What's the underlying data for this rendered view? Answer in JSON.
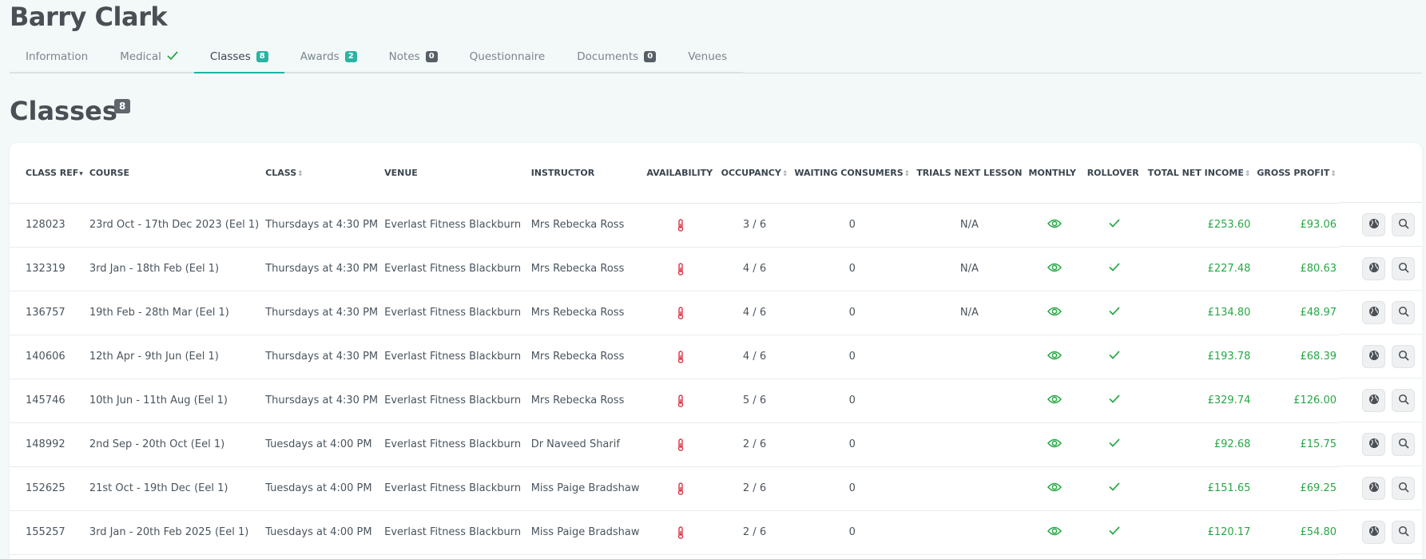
{
  "person": {
    "name": "Barry Clark"
  },
  "tabs": [
    {
      "label": "Information",
      "badge": null,
      "check": false,
      "active": false
    },
    {
      "label": "Medical",
      "badge": null,
      "check": true,
      "active": false
    },
    {
      "label": "Classes",
      "badge": "8",
      "check": false,
      "active": true
    },
    {
      "label": "Awards",
      "badge": "2",
      "check": false,
      "active": false
    },
    {
      "label": "Notes",
      "badge": "0",
      "check": false,
      "active": false
    },
    {
      "label": "Questionnaire",
      "badge": null,
      "check": false,
      "active": false
    },
    {
      "label": "Documents",
      "badge": "0",
      "check": false,
      "active": false
    },
    {
      "label": "Venues",
      "badge": null,
      "check": false,
      "active": false
    }
  ],
  "section": {
    "title": "Classes",
    "count": "8"
  },
  "table": {
    "headers": {
      "class_ref": "CLASS REF",
      "course": "COURSE",
      "class": "CLASS",
      "venue": "VENUE",
      "instructor": "INSTRUCTOR",
      "availability": "AVAILABILITY",
      "occupancy": "OCCUPANCY",
      "waiting": "WAITING CONSUMERS",
      "trials": "TRIALS NEXT LESSON",
      "monthly": "MONTHLY",
      "rollover": "ROLLOVER",
      "net_income": "TOTAL NET INCOME",
      "gross_profit": "GROSS PROFIT"
    },
    "rows": [
      {
        "ref": "128023",
        "course": "23rd Oct - 17th Dec 2023 (Eel 1)",
        "class": "Thursdays at 4:30 PM",
        "venue": "Everlast Fitness Blackburn",
        "instructor": "Mrs Rebecka Ross",
        "occupancy": "3 / 6",
        "waiting": "0",
        "trials": "N/A",
        "net": "£253.60",
        "gross": "£93.06"
      },
      {
        "ref": "132319",
        "course": "3rd Jan - 18th Feb (Eel 1)",
        "class": "Thursdays at 4:30 PM",
        "venue": "Everlast Fitness Blackburn",
        "instructor": "Mrs Rebecka Ross",
        "occupancy": "4 / 6",
        "waiting": "0",
        "trials": "N/A",
        "net": "£227.48",
        "gross": "£80.63"
      },
      {
        "ref": "136757",
        "course": "19th Feb - 28th Mar (Eel 1)",
        "class": "Thursdays at 4:30 PM",
        "venue": "Everlast Fitness Blackburn",
        "instructor": "Mrs Rebecka Ross",
        "occupancy": "4 / 6",
        "waiting": "0",
        "trials": "N/A",
        "net": "£134.80",
        "gross": "£48.97"
      },
      {
        "ref": "140606",
        "course": "12th Apr - 9th Jun (Eel 1)",
        "class": "Thursdays at 4:30 PM",
        "venue": "Everlast Fitness Blackburn",
        "instructor": "Mrs Rebecka Ross",
        "occupancy": "4 / 6",
        "waiting": "0",
        "trials": "",
        "net": "£193.78",
        "gross": "£68.39"
      },
      {
        "ref": "145746",
        "course": "10th Jun - 11th Aug (Eel 1)",
        "class": "Thursdays at 4:30 PM",
        "venue": "Everlast Fitness Blackburn",
        "instructor": "Mrs Rebecka Ross",
        "occupancy": "5 / 6",
        "waiting": "0",
        "trials": "",
        "net": "£329.74",
        "gross": "£126.00"
      },
      {
        "ref": "148992",
        "course": "2nd Sep - 20th Oct (Eel 1)",
        "class": "Tuesdays at 4:00 PM",
        "venue": "Everlast Fitness Blackburn",
        "instructor": "Dr Naveed Sharif",
        "occupancy": "2 / 6",
        "waiting": "0",
        "trials": "",
        "net": "£92.68",
        "gross": "£15.75"
      },
      {
        "ref": "152625",
        "course": "21st Oct - 19th Dec (Eel 1)",
        "class": "Tuesdays at 4:00 PM",
        "venue": "Everlast Fitness Blackburn",
        "instructor": "Miss Paige Bradshaw",
        "occupancy": "2 / 6",
        "waiting": "0",
        "trials": "",
        "net": "£151.65",
        "gross": "£69.25"
      },
      {
        "ref": "155257",
        "course": "3rd Jan - 20th Feb 2025 (Eel 1)",
        "class": "Tuesdays at 4:00 PM",
        "venue": "Everlast Fitness Blackburn",
        "instructor": "Miss Paige Bradshaw",
        "occupancy": "2 / 6",
        "waiting": "0",
        "trials": "",
        "net": "£120.17",
        "gross": "£54.80"
      }
    ]
  },
  "icons": {
    "availability": "thermometer-icon",
    "monthly": "eye-icon",
    "rollover": "check-icon",
    "action_1": "globe-icon",
    "action_2": "search-icon"
  },
  "colors": {
    "accent": "#1fb3a4",
    "money": "#28a745",
    "availability": "#dc3545"
  }
}
